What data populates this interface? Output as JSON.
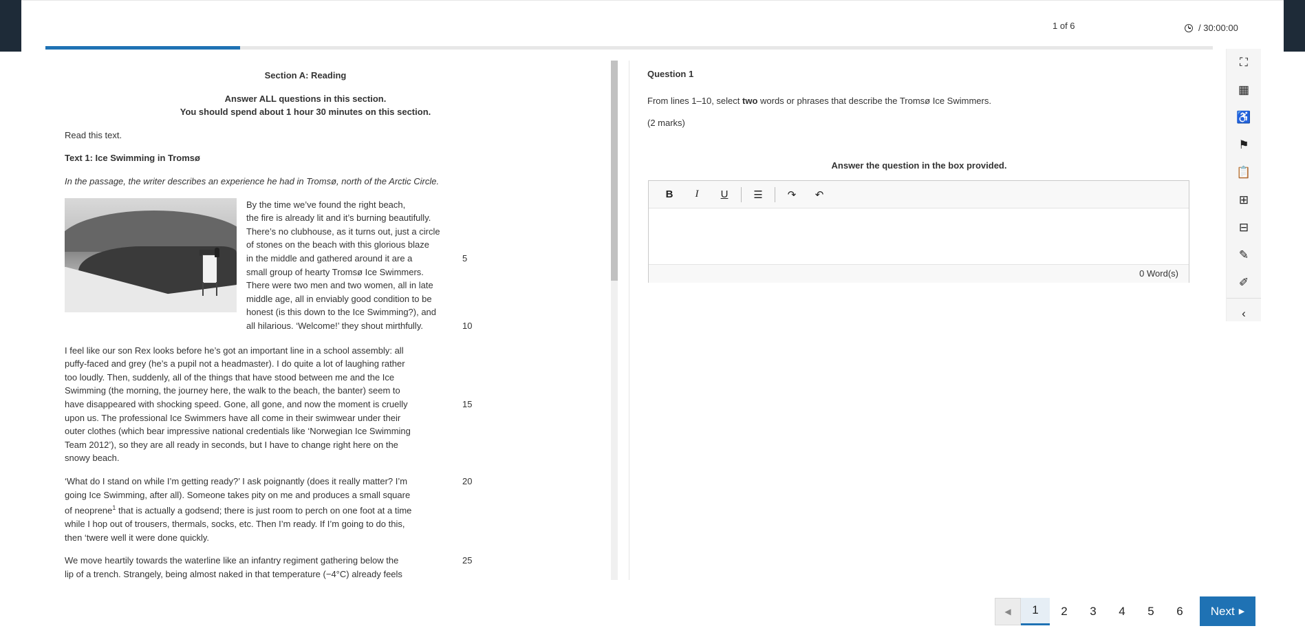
{
  "header": {
    "counter": "1 of 6",
    "timer": "/ 30:00:00",
    "progress_fraction": 0.1667
  },
  "reading": {
    "section_title": "Section A: Reading",
    "instr1": "Answer ALL questions in this section.",
    "instr2": "You should spend about 1 hour 30 minutes on this section.",
    "read_this": "Read this text.",
    "text_title": "Text 1: Ice Swimming in Tromsø",
    "intro": "In the passage, the writer describes an experience he had in Tromsø, north of the Arctic Circle.",
    "para1_lines": [
      "By the time we’ve found the right beach,",
      "the fire is already lit and it’s burning beautifully.",
      "There’s no clubhouse, as it turns out, just a circle",
      "of stones on the beach with this glorious blaze",
      "in the middle and gathered around it are a",
      "small group of hearty Tromsø Ice Swimmers.",
      "There were two men and two women, all in late",
      "middle age, all in enviably good condition to be",
      "honest (is this down to the Ice Swimming?), and",
      "all hilarious. ‘Welcome!’ they shout mirthfully."
    ],
    "para2_lines": [
      "I feel like our son Rex looks before he’s got an important line in a school assembly: all",
      "puffy-faced and grey (he’s a pupil not a headmaster). I do quite a lot of laughing rather",
      "too loudly. Then, suddenly, all of the things that have stood between me and the Ice",
      "Swimming (the morning, the journey here, the walk to the beach, the banter) seem to",
      "have disappeared with shocking speed. Gone, all gone, and now the moment is cruelly",
      "upon us. The professional Ice Swimmers have all come in their swimwear under their",
      "outer clothes (which bear impressive national credentials like ‘Norwegian Ice Swimming",
      "Team 2012’), so they are all ready in seconds, but I have to change right here on the",
      "snowy beach."
    ],
    "para3_lines": [
      "‘What do I stand on while I’m getting ready?’ I ask poignantly (does it really matter? I’m",
      "going Ice Swimming, after all). Someone takes pity on me and produces a small square",
      "of neoprene",
      "1",
      " that is actually a godsend; there is just room to perch on one foot at a time",
      "while I hop out of trousers, thermals, socks, etc. Then I’m ready. If I’m going to do this,",
      "then ‘twere well it were done quickly."
    ],
    "para4_lines": [
      "We move heartily towards the waterline like an infantry regiment gathering below the",
      "lip of a trench. Strangely, being almost naked in that temperature (−4°C) already feels"
    ],
    "line_numbers": [
      "5",
      "10",
      "15",
      "20",
      "25"
    ]
  },
  "question": {
    "title": "Question 1",
    "text_before": "From lines 1–10, select ",
    "text_bold": "two",
    "text_after": " words or phrases that describe the Tromsø Ice Swimmers.",
    "marks": "(2 marks)",
    "answer_label": "Answer the question in the box provided."
  },
  "editor": {
    "toolbar": {
      "bold": "B",
      "italic": "I",
      "underline": "U",
      "list": "☰",
      "redo": "↷",
      "undo": "↶"
    },
    "word_count": "0 Word(s)"
  },
  "side_tools": {
    "fullscreen": "⛶",
    "navigator": "▦",
    "accessibility": "♿",
    "flag": "⚑",
    "clipboard": "📋",
    "add_note": "⊞",
    "notes": "⊟",
    "pen": "✎",
    "highlighter": "✐",
    "collapse": "‹"
  },
  "pager": {
    "prev": "◀",
    "pages": [
      "1",
      "2",
      "3",
      "4",
      "5",
      "6"
    ],
    "active_page": "1",
    "next": "Next",
    "next_icon": "▶"
  },
  "colors": {
    "accent": "#1f72b4",
    "dark_edge": "#1e2b38"
  }
}
